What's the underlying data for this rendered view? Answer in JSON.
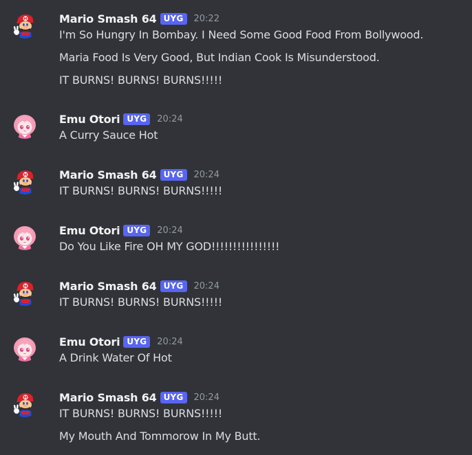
{
  "messages": [
    {
      "author": "Mario Smash 64",
      "badge": "UYG",
      "time": "20:22",
      "avatar": "mario-avatar-icon",
      "lines": [
        "I'm So Hungry In Bombay. I Need Some Good Food From Bollywood.",
        "Maria Food Is Very Good, But Indian Cook Is Misunderstood.",
        "IT BURNS! BURNS! BURNS!!!!!"
      ]
    },
    {
      "author": "Emu Otori",
      "badge": "UYG",
      "time": "20:24",
      "avatar": "emu-avatar-icon",
      "lines": [
        "A Curry Sauce Hot"
      ]
    },
    {
      "author": "Mario Smash 64",
      "badge": "UYG",
      "time": "20:24",
      "avatar": "mario-avatar-icon",
      "lines": [
        "IT BURNS! BURNS! BURNS!!!!!"
      ]
    },
    {
      "author": "Emu Otori",
      "badge": "UYG",
      "time": "20:24",
      "avatar": "emu-avatar-icon",
      "lines": [
        "Do You Like Fire OH MY GOD!!!!!!!!!!!!!!!!"
      ]
    },
    {
      "author": "Mario Smash 64",
      "badge": "UYG",
      "time": "20:24",
      "avatar": "mario-avatar-icon",
      "lines": [
        "IT BURNS! BURNS! BURNS!!!!!"
      ]
    },
    {
      "author": "Emu Otori",
      "badge": "UYG",
      "time": "20:24",
      "avatar": "emu-avatar-icon",
      "lines": [
        "A Drink Water Of Hot"
      ]
    },
    {
      "author": "Mario Smash 64",
      "badge": "UYG",
      "time": "20:24",
      "avatar": "mario-avatar-icon",
      "lines": [
        "IT BURNS! BURNS! BURNS!!!!!",
        "My Mouth And Tommorow In My Butt."
      ]
    }
  ],
  "colors": {
    "background": "#313338",
    "badge": "#5865f2",
    "username": "#f2f3f5",
    "timestamp": "#949ba4",
    "text": "#dbdee1"
  }
}
